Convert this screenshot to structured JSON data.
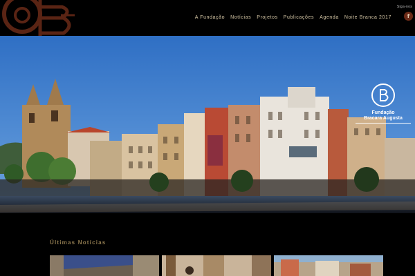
{
  "header": {
    "nav": [
      {
        "label": "A Fundação"
      },
      {
        "label": "Notícias"
      },
      {
        "label": "Projetos"
      },
      {
        "label": "Publicações"
      },
      {
        "label": "Agenda"
      },
      {
        "label": "Noite Branca 2017"
      }
    ],
    "follow_label": "Siga-nos",
    "facebook_glyph": "f"
  },
  "hero": {
    "brand_line1": "Fundação",
    "brand_line2": "Bracara Augusta"
  },
  "news": {
    "title": "Últimas Notícias"
  },
  "colors": {
    "nav_text": "#d8c9a8",
    "accent_gold": "#8f7a4f",
    "logo_brown": "#6b2a17"
  }
}
